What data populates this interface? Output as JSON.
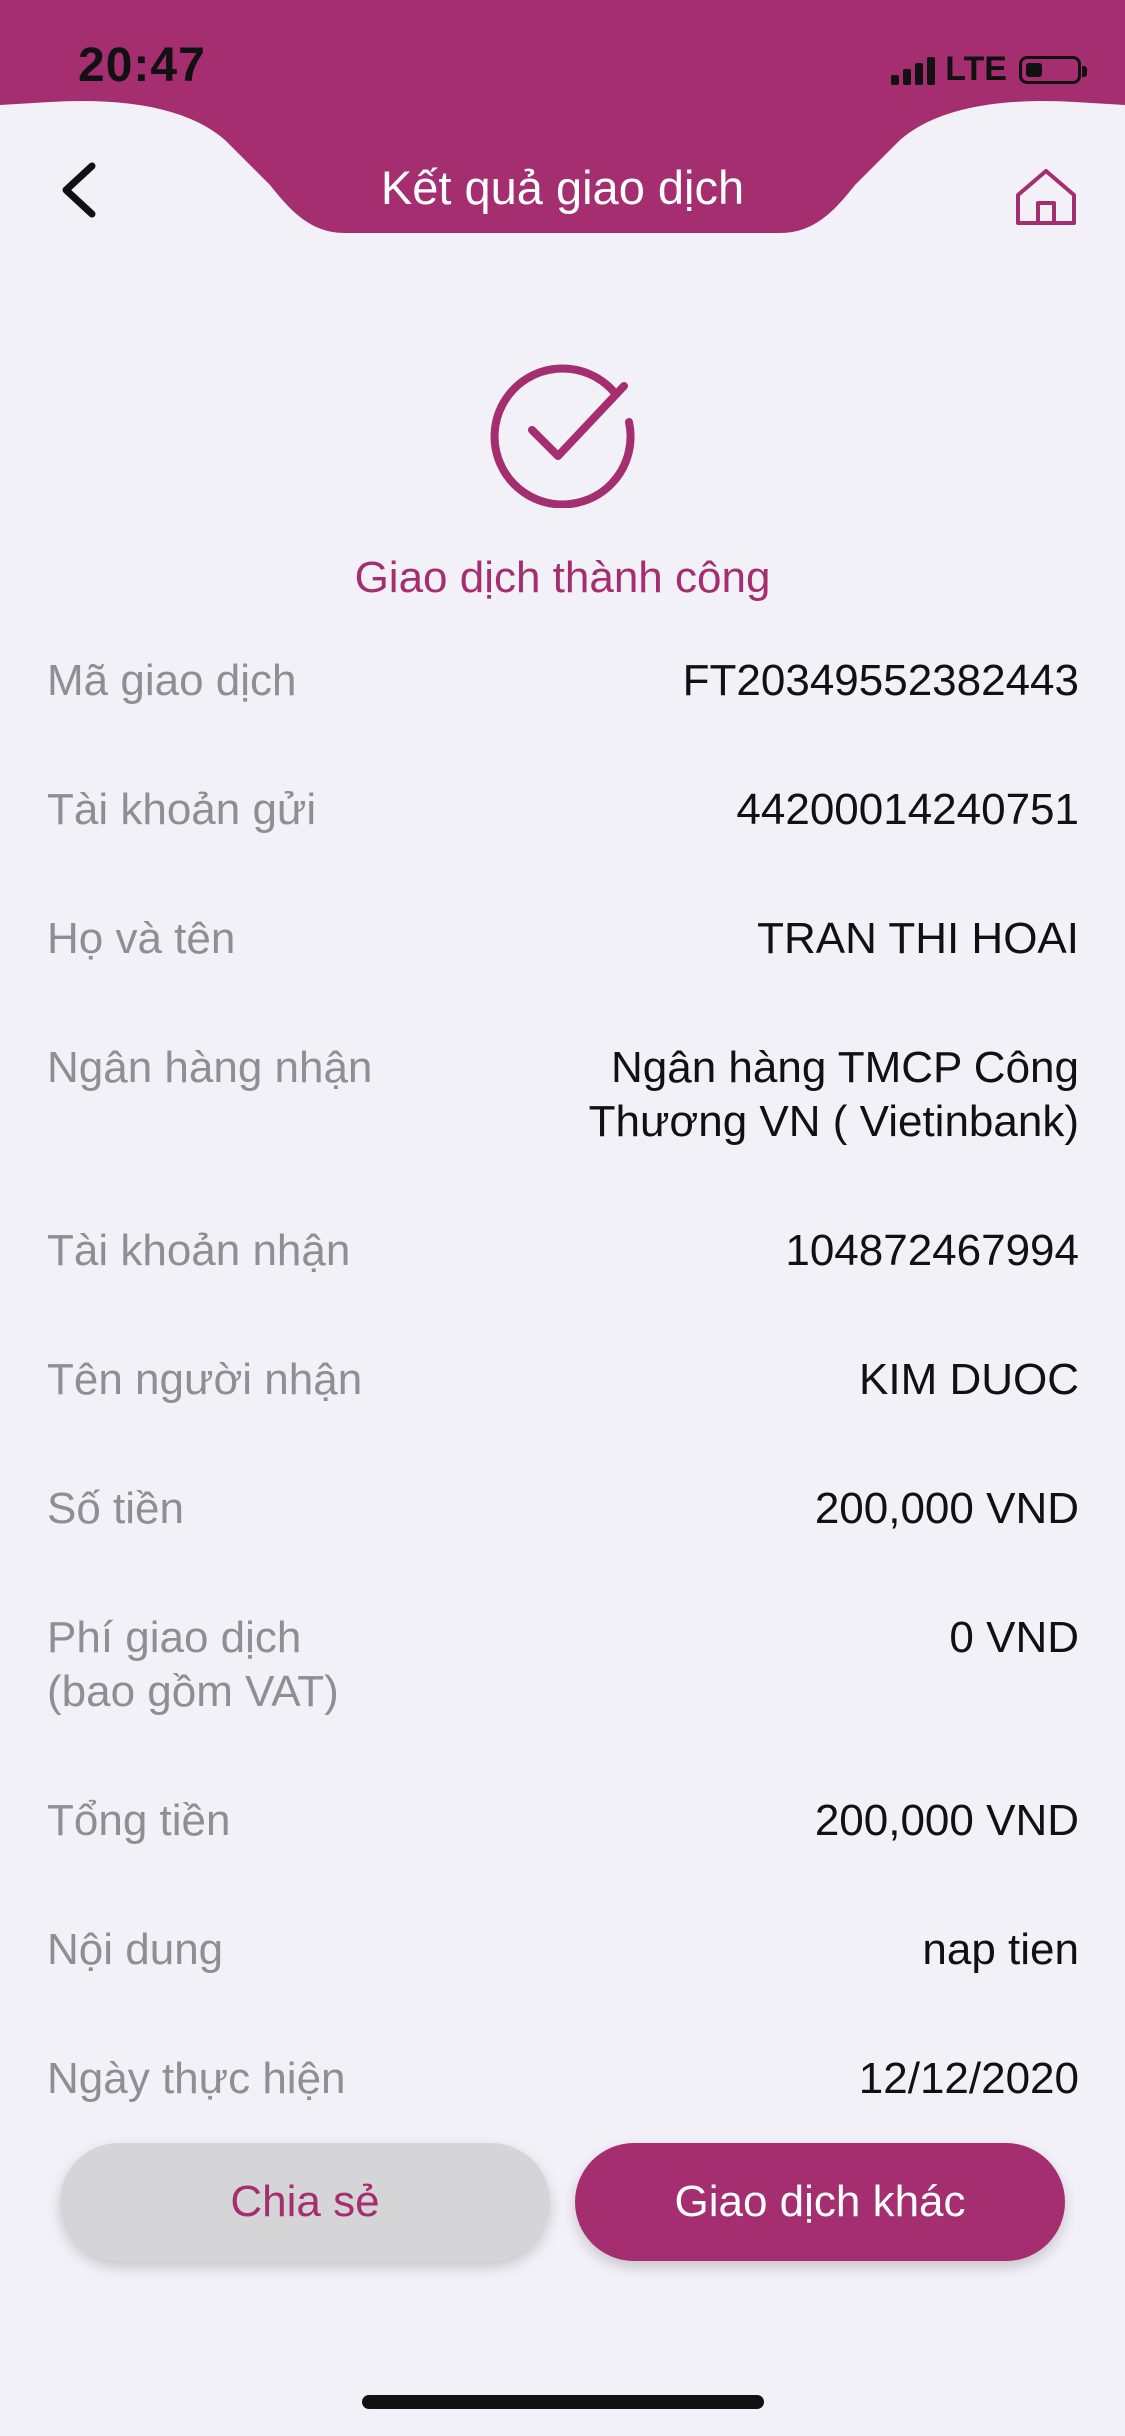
{
  "status_bar": {
    "time": "20:47",
    "network": "LTE"
  },
  "header": {
    "title": "Kết quả giao dịch",
    "back_icon": "chevron-left-icon",
    "home_icon": "home-icon"
  },
  "result": {
    "icon": "check-circle-icon",
    "message": "Giao dịch thành công"
  },
  "details": [
    {
      "label": "Mã giao dịch",
      "value": "FT20349552382443"
    },
    {
      "label": "Tài khoản gửi",
      "value": "44200014240751"
    },
    {
      "label": "Họ và tên",
      "value": "TRAN THI HOAI"
    },
    {
      "label": "Ngân hàng nhận",
      "value": "Ngân hàng TMCP Công\nThương VN ( Vietinbank)"
    },
    {
      "label": "Tài khoản nhận",
      "value": "104872467994"
    },
    {
      "label": "Tên người nhận",
      "value": "KIM DUOC"
    },
    {
      "label": "Số tiền",
      "value": "200,000 VND"
    },
    {
      "label": "Phí giao dịch\n(bao gồm VAT)",
      "value": "0 VND"
    },
    {
      "label": "Tổng tiền",
      "value": "200,000 VND"
    },
    {
      "label": "Nội dung",
      "value": "nap tien"
    },
    {
      "label": "Ngày thực hiện",
      "value": "12/12/2020"
    }
  ],
  "buttons": {
    "share": "Chia sẻ",
    "other": "Giao dịch khác"
  },
  "colors": {
    "brand": "#a42e6f",
    "background": "#f2f1f7",
    "label": "#8e8e93"
  }
}
